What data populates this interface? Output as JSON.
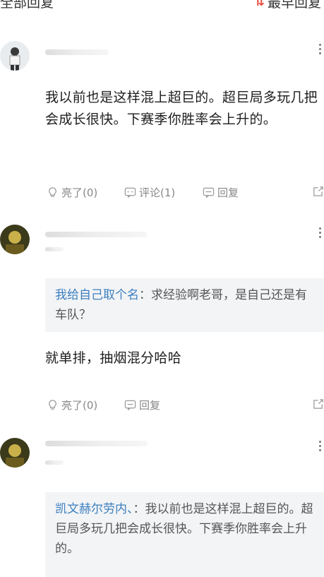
{
  "header": {
    "title": "全部回复",
    "sort_label": "最早回复",
    "sort_icon": "sort-arrows-icon"
  },
  "comments": [
    {
      "text": "我以前也是这样混上超巨的。超巨局多玩几把会成长很快。下赛季你胜率会上升的。",
      "like": "亮了(0)",
      "comment": "评论(1)",
      "reply": "回复"
    },
    {
      "quote_name": "我给自己取个名",
      "quote_text": "：求经验啊老哥，是自己还是有车队？",
      "text": "就单排，抽烟混分哈哈",
      "like": "亮了(0)",
      "reply": "回复"
    },
    {
      "quote_name": "凯文赫尔劳内、",
      "quote_text": "：我以前也是这样混上超巨的。超巨局多玩几把会成长很快。下赛季你胜率会上升的。"
    }
  ],
  "colors": {
    "accent": "#e84b3c",
    "link": "#3c7fbf",
    "quote_bg": "#f3f4f6"
  }
}
